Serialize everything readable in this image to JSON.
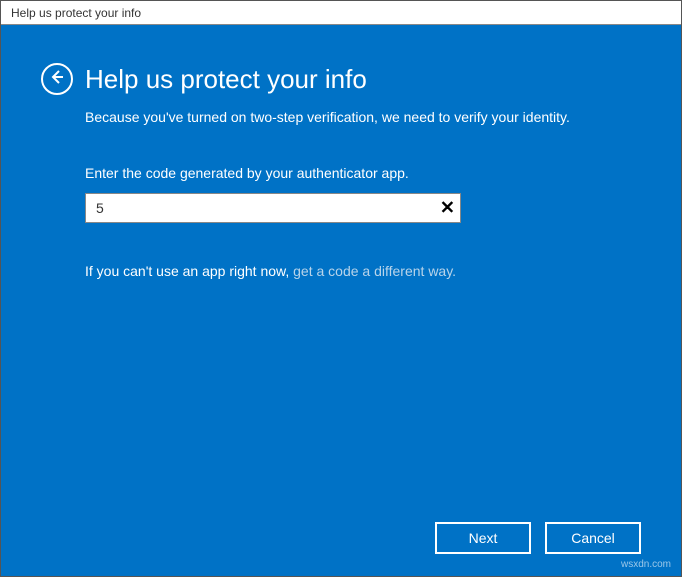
{
  "window": {
    "title": "Help us protect your info"
  },
  "header": {
    "heading": "Help us protect your info"
  },
  "body": {
    "subtitle": "Because you've turned on two-step verification, we need to verify your identity.",
    "label": "Enter the code generated by your authenticator app.",
    "code_value": "5",
    "alt_prefix": "If you can't use an app right now, ",
    "alt_link": "get a code a different way."
  },
  "footer": {
    "next": "Next",
    "cancel": "Cancel"
  },
  "watermark": "wsxdn.com"
}
